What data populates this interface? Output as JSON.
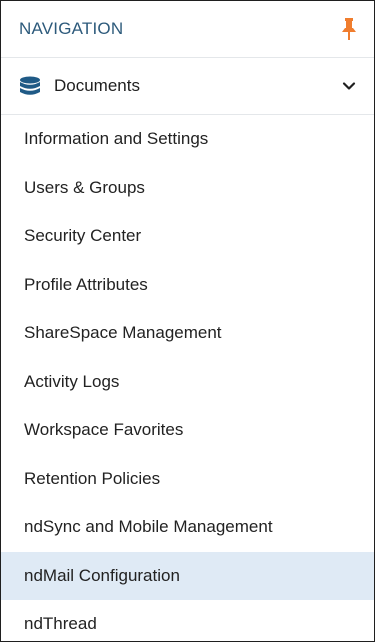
{
  "header": {
    "title": "NAVIGATION",
    "pin_icon": "pin-icon",
    "pin_color": "#f07d2e"
  },
  "section": {
    "label": "Documents",
    "icon": "database-icon",
    "icon_color": "#1f5a86",
    "expanded": true
  },
  "menu": {
    "items": [
      {
        "label": "Information and Settings",
        "active": false
      },
      {
        "label": "Users & Groups",
        "active": false
      },
      {
        "label": "Security Center",
        "active": false
      },
      {
        "label": "Profile Attributes",
        "active": false
      },
      {
        "label": "ShareSpace Management",
        "active": false
      },
      {
        "label": "Activity Logs",
        "active": false
      },
      {
        "label": "Workspace Favorites",
        "active": false
      },
      {
        "label": "Retention Policies",
        "active": false
      },
      {
        "label": "ndSync and Mobile Management",
        "active": false
      },
      {
        "label": "ndMail Configuration",
        "active": true
      },
      {
        "label": "ndThread",
        "active": false
      }
    ],
    "active_bg": "#dfeaf5"
  }
}
